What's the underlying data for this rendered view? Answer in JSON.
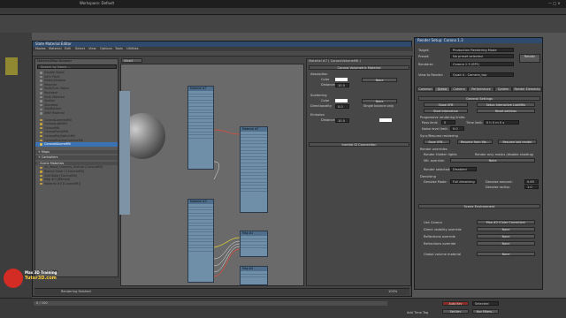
{
  "app": {
    "title": "Workspace: Default"
  },
  "material_editor": {
    "title": "Slate Material Editor",
    "menus": [
      "Modes",
      "Material",
      "Edit",
      "Select",
      "View",
      "Options",
      "Tools",
      "Utilities"
    ],
    "browser_title": "Material/Map Browser",
    "search_placeholder": "Search by Name ...",
    "materials": [
      "Double Sided",
      "Ink'n Paint",
      "Matte/Shadow",
      "Morpher",
      "Multi/Sub-Object",
      "Raytrace",
      "Shell Material",
      "Shellac",
      "Standard",
      "Top/Bottom",
      "XRef Material"
    ],
    "corona_materials": [
      "CoronaLayeredMtl",
      "CoronaLightMtl",
      "CoronaMtl",
      "CoronaPortalMtl",
      "CoronaRaySwitchMtl",
      "CoronaShadowCatcherMtl",
      "CoronaVolumeMtl"
    ],
    "selected_material": "CoronaVolumeMtl",
    "section_maps": "+ Maps",
    "section_controllers": "+ Controllers",
    "section_scene_materials": "- Scene Materials",
    "scene_materials": [
      "00_Wood_Grooves_Texture [CoronaMtl]",
      "Blanco Shoe 1 [CoronaMtl]",
      "Gnd Bake [CoronaMtl]",
      "Map #1 [Bitmap]",
      "Material #3 [CoronaMtl]"
    ],
    "sample_slots_label": "Sample Slots",
    "view_tab": "View1",
    "rendering_status": "Rendering finished",
    "params_title": "Material #7  ( CoronaVolumeMtl )",
    "params_section": "Corona Volumetric Material",
    "params_rows": [
      {
        "label": "Absorption",
        "value": ""
      },
      {
        "label": "Color",
        "value": "None"
      },
      {
        "label": "Distance",
        "value": "10.0"
      },
      {
        "label": "Scattering",
        "value": ""
      },
      {
        "label": "Color",
        "value": "None"
      },
      {
        "label": "Directionality",
        "value": "0.0"
      },
      {
        "label": "Emission",
        "value": ""
      },
      {
        "label": "Distance",
        "value": "10.0"
      }
    ],
    "single_bounce_label": "Single bounce only",
    "params_footer": "Inertial Gi Connection",
    "zoom": "100%"
  },
  "render_setup": {
    "title": "Render Setup: Corona 1.3",
    "rows": [
      {
        "label": "Target:",
        "value": "Production Rendering Mode"
      },
      {
        "label": "Preset:",
        "value": "No preset selected"
      },
      {
        "label": "Renderer:",
        "value": "Corona 1.3 (SP1)"
      },
      {
        "label": "View to Render:",
        "value": "Quad 4 - Camera_top"
      }
    ],
    "render_button": "Render",
    "tabs": [
      "Common",
      "Scene",
      "Camera",
      "Performance",
      "System",
      "Render Elements"
    ],
    "active_tab": "Scene",
    "general_settings": "General Settings",
    "btn_show_vfb": "Show VFB",
    "btn_interactive": "Setup Interactive LightMix",
    "btn_start_interactive": "Start Interactive",
    "btn_reset_settings": "Reset settings",
    "progressive_label": "Progressive rendering limits:",
    "limit_rows": [
      {
        "label": "Pass limit:",
        "value": "0"
      },
      {
        "label": "Time limit:",
        "value": "0 h 0 m 0 s"
      },
      {
        "label": "Noise level limit:",
        "value": "0.0"
      }
    ],
    "sync_label": "Sync/Resume rendering",
    "sync_btns": [
      "Save VFB...",
      "Resume from file...",
      "Resume last render"
    ],
    "render_overrides": "Render overrides",
    "overrides": [
      "Render Hidden lights",
      "Render only masks (disable shading)"
    ],
    "mtl_override_label": "Mtl. override:",
    "mtl_override_value": "None",
    "render_selected": "Render selected:",
    "render_selected_value": "Disabled",
    "denoising": "Denoising",
    "denoise_mode": "Denoise Mode:",
    "denoise_mode_value": "Full denoising",
    "denoise_amount": "Denoise amount:",
    "denoise_amount_value": "0.65",
    "denoise_radius": "Denoise radius:",
    "denoise_radius_value": "1.0",
    "scene_env": "Scene Environment",
    "scene_env_rows": [
      {
        "label": "Use Corona",
        "value": "Map #2 (Color Correction)"
      },
      {
        "label": "Direct visibility override",
        "value": "None"
      },
      {
        "label": "Reflections override",
        "value": "None"
      },
      {
        "label": "Refractions override",
        "value": "None"
      }
    ],
    "global_volume": "Global volume material",
    "global_volume_value": "None"
  },
  "tutorial_logo": {
    "line1": "Max 3D Training",
    "line2": "Tutor3D.com"
  },
  "status": {
    "frame": "0 / 100",
    "coords": "Add Time Tag",
    "auto_key": "Auto Key",
    "selected": "Selected",
    "set_key": "Set Key",
    "key_filters": "Key Filters..."
  },
  "colors": {
    "accent": "#3b72b4",
    "node_blue": "#6f8ea8",
    "wire_red": "#e24a3a",
    "wire_yellow": "#e4d23a"
  }
}
